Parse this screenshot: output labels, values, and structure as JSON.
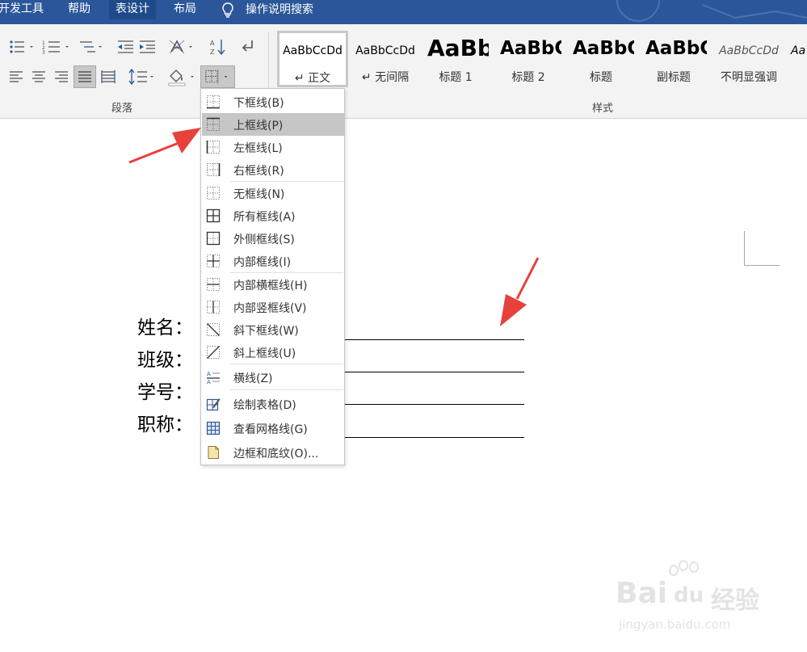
{
  "tabs": [
    {
      "label": "开发工具"
    },
    {
      "label": "帮助"
    },
    {
      "label": "表设计",
      "active": true
    },
    {
      "label": "布局"
    }
  ],
  "tell_me": {
    "label": "操作说明搜索",
    "icon": "lightbulb-icon"
  },
  "ribbon": {
    "paragraph_group_label": "段落",
    "styles_group_label": "样式",
    "styles": [
      {
        "sample": "AaBbCcDd",
        "name": "↵ 正文",
        "selected": true
      },
      {
        "sample": "AaBbCcDd",
        "name": "↵ 无间隔"
      },
      {
        "sample": "AaBb",
        "name": "标题 1"
      },
      {
        "sample": "AaBbC",
        "name": "标题 2"
      },
      {
        "sample": "AaBbC",
        "name": "标题"
      },
      {
        "sample": "AaBbC",
        "name": "副标题"
      },
      {
        "sample": "AaBbCcDd",
        "name": "不明显强调"
      },
      {
        "sample": "Aa",
        "name": ""
      }
    ]
  },
  "border_menu": {
    "items": [
      {
        "label": "下框线(B)",
        "icon": "bottom-border-icon"
      },
      {
        "label": "上框线(P)",
        "icon": "top-border-icon",
        "highlighted": true
      },
      {
        "label": "左框线(L)",
        "icon": "left-border-icon"
      },
      {
        "label": "右框线(R)",
        "icon": "right-border-icon"
      },
      {
        "label": "无框线(N)",
        "icon": "no-border-icon"
      },
      {
        "label": "所有框线(A)",
        "icon": "all-borders-icon"
      },
      {
        "label": "外侧框线(S)",
        "icon": "outside-borders-icon"
      },
      {
        "label": "内部框线(I)",
        "icon": "inside-borders-icon"
      },
      {
        "label": "内部横框线(H)",
        "icon": "inside-horizontal-border-icon"
      },
      {
        "label": "内部竖框线(V)",
        "icon": "inside-vertical-border-icon"
      },
      {
        "label": "斜下框线(W)",
        "icon": "diagonal-down-border-icon"
      },
      {
        "label": "斜上框线(U)",
        "icon": "diagonal-up-border-icon"
      },
      {
        "label": "横线(Z)",
        "icon": "horizontal-line-icon"
      },
      {
        "label": "绘制表格(D)",
        "icon": "draw-table-icon"
      },
      {
        "label": "查看网格线(G)",
        "icon": "view-gridlines-icon"
      },
      {
        "label": "边框和底纹(O)...",
        "icon": "borders-shading-icon"
      }
    ]
  },
  "document": {
    "fields": [
      {
        "label": "姓名："
      },
      {
        "label": "班级："
      },
      {
        "label": "学号："
      },
      {
        "label": "职称："
      }
    ]
  },
  "watermark": {
    "brand": "Bai",
    "brand2": "du",
    "product": "经验",
    "url": "jingyan.baidu.com"
  },
  "colors": {
    "title_bar": "#2b579a",
    "arrow": "#e8403a",
    "menu_highlight": "#c6c6c6"
  }
}
